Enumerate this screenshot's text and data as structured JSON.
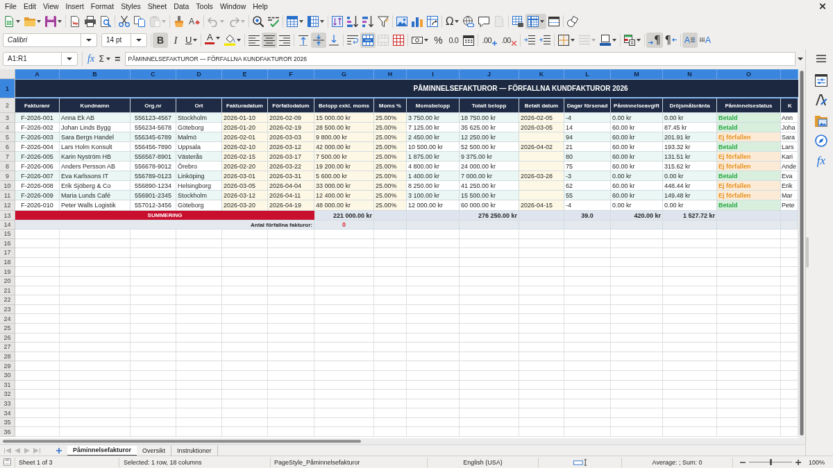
{
  "menu_bar": {
    "items": [
      "File",
      "Edit",
      "View",
      "Insert",
      "Format",
      "Styles",
      "Sheet",
      "Data",
      "Tools",
      "Window",
      "Help"
    ]
  },
  "standard_toolbar": {
    "groups": [
      [
        {
          "kind": "new",
          "on": false,
          "disabled": false,
          "menu": true
        },
        {
          "kind": "open",
          "on": false,
          "disabled": false,
          "menu": true
        },
        {
          "kind": "save",
          "on": false,
          "disabled": false,
          "menu": true
        }
      ],
      [
        {
          "kind": "pdf",
          "on": false,
          "disabled": false,
          "menu": false
        },
        {
          "kind": "print",
          "on": false,
          "disabled": false,
          "menu": false
        },
        {
          "kind": "preview",
          "on": false,
          "disabled": false,
          "menu": false
        }
      ],
      [
        {
          "kind": "cut",
          "on": false,
          "disabled": false,
          "menu": false
        },
        {
          "kind": "copy",
          "on": false,
          "disabled": false,
          "menu": false
        },
        {
          "kind": "paste",
          "on": false,
          "disabled": true,
          "menu": true
        }
      ],
      [
        {
          "kind": "clone",
          "on": false,
          "disabled": false,
          "menu": false
        },
        {
          "kind": "clear",
          "label": "A",
          "on": false,
          "disabled": false,
          "menu": false
        }
      ],
      [
        {
          "kind": "undo",
          "on": false,
          "disabled": true,
          "menu": true
        },
        {
          "kind": "redo",
          "on": false,
          "disabled": true,
          "menu": true
        }
      ],
      [
        {
          "kind": "find",
          "on": false,
          "disabled": false,
          "menu": false
        },
        {
          "kind": "spelling",
          "on": false,
          "disabled": false,
          "menu": false
        }
      ],
      [
        {
          "kind": "row",
          "on": false,
          "disabled": false,
          "menu": true
        },
        {
          "kind": "column",
          "on": false,
          "disabled": false,
          "menu": true
        }
      ],
      [
        {
          "kind": "sort",
          "on": false,
          "disabled": false,
          "menu": false
        },
        {
          "kind": "ascending",
          "on": false,
          "disabled": false,
          "menu": false
        },
        {
          "kind": "descending",
          "on": false,
          "disabled": false,
          "menu": false
        },
        {
          "kind": "filter",
          "on": false,
          "disabled": false,
          "menu": false
        }
      ],
      [
        {
          "kind": "image",
          "on": false,
          "disabled": false,
          "menu": false
        },
        {
          "kind": "chart",
          "on": false,
          "disabled": false,
          "menu": false
        },
        {
          "kind": "pivot",
          "on": false,
          "disabled": false,
          "menu": false
        }
      ],
      [
        {
          "kind": "symbol",
          "label": "Ω",
          "on": false,
          "disabled": false,
          "menu": true
        },
        {
          "kind": "hyperlink",
          "on": false,
          "disabled": false,
          "menu": false
        },
        {
          "kind": "comment",
          "on": false,
          "disabled": false,
          "menu": false
        },
        {
          "kind": "headerfooter",
          "on": false,
          "disabled": true,
          "menu": false
        }
      ],
      [
        {
          "kind": "printarea",
          "on": false,
          "disabled": false,
          "menu": false
        },
        {
          "kind": "freeze",
          "on": true,
          "disabled": false,
          "menu": true
        },
        {
          "kind": "split",
          "on": false,
          "disabled": false,
          "menu": false
        }
      ],
      [
        {
          "kind": "draw",
          "on": false,
          "disabled": false,
          "menu": false
        }
      ]
    ]
  },
  "formatting_toolbar": {
    "font_name": "Calibri",
    "font_size": "14 pt",
    "groups": [
      [
        {
          "kind": "bold",
          "label": "B",
          "on": true,
          "disabled": false,
          "menu": false
        },
        {
          "kind": "italic",
          "label": "I",
          "on": false,
          "disabled": false,
          "menu": false
        },
        {
          "kind": "underline",
          "label": "U",
          "on": false,
          "disabled": false,
          "menu": true
        }
      ],
      [
        {
          "kind": "fontcolor",
          "label": "A",
          "on": false,
          "disabled": false,
          "menu": true
        },
        {
          "kind": "highlight",
          "on": false,
          "disabled": false,
          "menu": true
        }
      ],
      [
        {
          "kind": "alignleft",
          "on": false,
          "disabled": false,
          "menu": false
        },
        {
          "kind": "aligncenter",
          "on": true,
          "disabled": false,
          "menu": false
        },
        {
          "kind": "alignright",
          "on": false,
          "disabled": false,
          "menu": false
        }
      ],
      [
        {
          "kind": "top",
          "on": false,
          "disabled": false,
          "menu": false
        },
        {
          "kind": "middle",
          "on": true,
          "disabled": false,
          "menu": false
        },
        {
          "kind": "bottom",
          "on": false,
          "disabled": false,
          "menu": false
        }
      ],
      [
        {
          "kind": "wrap",
          "on": false,
          "disabled": false,
          "menu": false
        },
        {
          "kind": "mergecenter",
          "on": true,
          "disabled": false,
          "menu": false
        },
        {
          "kind": "merge",
          "on": false,
          "disabled": true,
          "menu": false
        },
        {
          "kind": "unmerge",
          "on": false,
          "disabled": false,
          "menu": false
        }
      ],
      [
        {
          "kind": "currency",
          "on": false,
          "disabled": false,
          "menu": true
        },
        {
          "kind": "percent",
          "label": "%",
          "on": false,
          "disabled": false,
          "menu": false
        },
        {
          "kind": "number",
          "label": "0.0",
          "on": false,
          "disabled": false,
          "menu": false
        },
        {
          "kind": "date",
          "on": false,
          "disabled": false,
          "menu": false
        }
      ],
      [
        {
          "kind": "adddecimal",
          "label": ".00",
          "on": false,
          "disabled": false,
          "menu": false
        },
        {
          "kind": "deletedecimal",
          "label": ".00",
          "on": false,
          "disabled": false,
          "menu": false
        }
      ],
      [
        {
          "kind": "indent",
          "on": false,
          "disabled": false,
          "menu": false
        },
        {
          "kind": "outdent",
          "on": false,
          "disabled": false,
          "menu": false
        }
      ],
      [
        {
          "kind": "borders",
          "on": false,
          "disabled": false,
          "menu": true
        },
        {
          "kind": "borderstyle",
          "on": false,
          "disabled": true,
          "menu": true
        },
        {
          "kind": "bordercolor",
          "on": false,
          "disabled": false,
          "menu": true
        }
      ],
      [
        {
          "kind": "conditional",
          "on": false,
          "disabled": false,
          "menu": true
        }
      ],
      [
        {
          "kind": "ltr",
          "label": "¶",
          "on": true,
          "disabled": false,
          "menu": false
        },
        {
          "kind": "rtl",
          "label": "¶",
          "on": false,
          "disabled": false,
          "menu": false
        }
      ],
      [
        {
          "kind": "textdirection",
          "label": "A",
          "on": true,
          "disabled": false,
          "menu": false
        },
        {
          "kind": "vertical",
          "label": "A",
          "on": false,
          "disabled": false,
          "menu": false
        }
      ]
    ]
  },
  "formula_bar": {
    "name_box": "A1:R1",
    "function_wizard": "fx",
    "sum": "Σ",
    "equals": "=",
    "formula": "PÅMINNELSEFAKTUROR — FÖRFALLNA KUNDFAKTUROR 2026"
  },
  "sidebar": {
    "tabs": [
      {
        "kind": "properties"
      },
      {
        "kind": "styles"
      },
      {
        "kind": "gallery"
      },
      {
        "kind": "navigator"
      },
      {
        "kind": "functions",
        "label": "fx"
      }
    ]
  },
  "sheet": {
    "columns": [
      {
        "label": "A",
        "selected": true
      },
      {
        "label": "B",
        "selected": true
      },
      {
        "label": "C",
        "selected": true
      },
      {
        "label": "D",
        "selected": true
      },
      {
        "label": "E",
        "selected": true
      },
      {
        "label": "F",
        "selected": true
      },
      {
        "label": "G",
        "selected": true
      },
      {
        "label": "H",
        "selected": true
      },
      {
        "label": "I",
        "selected": true
      },
      {
        "label": "J",
        "selected": true
      },
      {
        "label": "K",
        "selected": true
      },
      {
        "label": "L",
        "selected": true
      },
      {
        "label": "M",
        "selected": true
      },
      {
        "label": "N",
        "selected": true
      },
      {
        "label": "O",
        "selected": true
      }
    ],
    "row_headers": [
      {
        "label": "1",
        "selected": true
      },
      {
        "label": "2",
        "selected": false
      },
      {
        "label": "3",
        "selected": false
      },
      {
        "label": "4",
        "selected": false
      },
      {
        "label": "5",
        "selected": false
      },
      {
        "label": "6",
        "selected": false
      },
      {
        "label": "7",
        "selected": false
      },
      {
        "label": "8",
        "selected": false
      },
      {
        "label": "9",
        "selected": false
      },
      {
        "label": "10",
        "selected": false
      },
      {
        "label": "11",
        "selected": false
      },
      {
        "label": "12",
        "selected": false
      },
      {
        "label": "13",
        "selected": false
      },
      {
        "label": "14",
        "selected": false
      },
      {
        "label": "15",
        "selected": false
      },
      {
        "label": "16",
        "selected": false
      },
      {
        "label": "17",
        "selected": false
      },
      {
        "label": "18",
        "selected": false
      },
      {
        "label": "19",
        "selected": false
      },
      {
        "label": "20",
        "selected": false
      },
      {
        "label": "21",
        "selected": false
      },
      {
        "label": "22",
        "selected": false
      },
      {
        "label": "23",
        "selected": false
      },
      {
        "label": "24",
        "selected": false
      },
      {
        "label": "25",
        "selected": false
      },
      {
        "label": "26",
        "selected": false
      },
      {
        "label": "27",
        "selected": false
      },
      {
        "label": "28",
        "selected": false
      },
      {
        "label": "29",
        "selected": false
      },
      {
        "label": "30",
        "selected": false
      },
      {
        "label": "31",
        "selected": false
      },
      {
        "label": "32",
        "selected": false
      },
      {
        "label": "33",
        "selected": false
      },
      {
        "label": "34",
        "selected": false
      },
      {
        "label": "35",
        "selected": false
      },
      {
        "label": "36",
        "selected": false
      }
    ],
    "title": "PÅMINNELSEFAKTUROR — FÖRFALLNA KUNDFAKTUROR 2026",
    "header": [
      "Fakturanr",
      "Kundnamn",
      "Org.nr",
      "Ort",
      "Fakturadatum",
      "Förfallodatum",
      "Belopp exkl. moms",
      "Moms %",
      "Momsbelopp",
      "Totalt belopp",
      "Betalt datum",
      "Dagar försenad",
      "Påminnelseavgift",
      "Dröjsmålsränta",
      "Påminnelsestatus",
      "K"
    ],
    "rows": [
      {
        "invoice_no": "F-2026-001",
        "customer": "Anna Ek AB",
        "org_no": "556123-4567",
        "city": "Stockholm",
        "invoice_date": "2026-01-10",
        "due_date": "2026-02-09",
        "amount_excl_vat": "15 000.00 kr",
        "vat_rate": "25.00%",
        "vat_amount": "3 750.00 kr",
        "total": "18 750.00 kr",
        "paid_date": "2026-02-05",
        "days_late": "-4",
        "reminder_fee": "0.00 kr",
        "interest": "0.00 kr",
        "status": {
          "text": "Betald",
          "color": "#27a844"
        },
        "column_16": "Ann"
      },
      {
        "invoice_no": "F-2026-002",
        "customer": "Johan Linds Bygg",
        "org_no": "556234-5678",
        "city": "Göteborg",
        "invoice_date": "2026-01-20",
        "due_date": "2026-02-19",
        "amount_excl_vat": "28 500.00 kr",
        "vat_rate": "25.00%",
        "vat_amount": "7 125.00 kr",
        "total": "35 625.00 kr",
        "paid_date": "2026-03-05",
        "days_late": "14",
        "reminder_fee": "60.00 kr",
        "interest": "87.45 kr",
        "status": {
          "text": "Betald",
          "color": "#27a844"
        },
        "column_16": "Joha"
      },
      {
        "invoice_no": "F-2026-003",
        "customer": "Sara Bergs Handel",
        "org_no": "556345-6789",
        "city": "Malmö",
        "invoice_date": "2026-02-01",
        "due_date": "2026-03-03",
        "amount_excl_vat": "9 800.00 kr",
        "vat_rate": "25.00%",
        "vat_amount": "2 450.00 kr",
        "total": "12 250.00 kr",
        "days_late": "94",
        "reminder_fee": "60.00 kr",
        "interest": "201.91 kr",
        "status": {
          "text": "Ej förfallen",
          "color": "#e8901c"
        },
        "column_16": "Sara"
      },
      {
        "invoice_no": "F-2026-004",
        "customer": "Lars Holm Konsult",
        "org_no": "556456-7890",
        "city": "Uppsala",
        "invoice_date": "2026-02-10",
        "due_date": "2026-03-12",
        "amount_excl_vat": "42 000.00 kr",
        "vat_rate": "25.00%",
        "vat_amount": "10 500.00 kr",
        "total": "52 500.00 kr",
        "paid_date": "2026-04-02",
        "days_late": "21",
        "reminder_fee": "60.00 kr",
        "interest": "193.32 kr",
        "status": {
          "text": "Betald",
          "color": "#27a844"
        },
        "column_16": "Lars"
      },
      {
        "invoice_no": "F-2026-005",
        "customer": "Karin Nyström HB",
        "org_no": "556567-8901",
        "city": "Västerås",
        "invoice_date": "2026-02-15",
        "due_date": "2026-03-17",
        "amount_excl_vat": "7 500.00 kr",
        "vat_rate": "25.00%",
        "vat_amount": "1 875.00 kr",
        "total": "9 375.00 kr",
        "days_late": "80",
        "reminder_fee": "60.00 kr",
        "interest": "131.51 kr",
        "status": {
          "text": "Ej förfallen",
          "color": "#e8901c"
        },
        "column_16": "Kari"
      },
      {
        "invoice_no": "F-2026-006",
        "customer": "Anders Persson AB",
        "org_no": "556678-9012",
        "city": "Örebro",
        "invoice_date": "2026-02-20",
        "due_date": "2026-03-22",
        "amount_excl_vat": "19 200.00 kr",
        "vat_rate": "25.00%",
        "vat_amount": "4 800.00 kr",
        "total": "24 000.00 kr",
        "days_late": "75",
        "reminder_fee": "60.00 kr",
        "interest": "315.62 kr",
        "status": {
          "text": "Ej förfallen",
          "color": "#e8901c"
        },
        "column_16": "Ande"
      },
      {
        "invoice_no": "F-2026-007",
        "customer": "Eva Karlssons IT",
        "org_no": "556789-0123",
        "city": "Linköping",
        "invoice_date": "2026-03-01",
        "due_date": "2026-03-31",
        "amount_excl_vat": "5 600.00 kr",
        "vat_rate": "25.00%",
        "vat_amount": "1 400.00 kr",
        "total": "7 000.00 kr",
        "paid_date": "2026-03-28",
        "days_late": "-3",
        "reminder_fee": "0.00 kr",
        "interest": "0.00 kr",
        "status": {
          "text": "Betald",
          "color": "#27a844"
        },
        "column_16": "Eva"
      },
      {
        "invoice_no": "F-2026-008",
        "customer": "Erik Sjöberg & Co",
        "org_no": "556890-1234",
        "city": "Helsingborg",
        "invoice_date": "2026-03-05",
        "due_date": "2026-04-04",
        "amount_excl_vat": "33 000.00 kr",
        "vat_rate": "25.00%",
        "vat_amount": "8 250.00 kr",
        "total": "41 250.00 kr",
        "days_late": "62",
        "reminder_fee": "60.00 kr",
        "interest": "448.44 kr",
        "status": {
          "text": "Ej förfallen",
          "color": "#e8901c"
        },
        "column_16": "Erik"
      },
      {
        "invoice_no": "F-2026-009",
        "customer": "Maria Lunds Café",
        "org_no": "556901-2345",
        "city": "Stockholm",
        "invoice_date": "2026-03-12",
        "due_date": "2026-04-11",
        "amount_excl_vat": "12 400.00 kr",
        "vat_rate": "25.00%",
        "vat_amount": "3 100.00 kr",
        "total": "15 500.00 kr",
        "days_late": "55",
        "reminder_fee": "60.00 kr",
        "interest": "149.48 kr",
        "status": {
          "text": "Ej förfallen",
          "color": "#e8901c"
        },
        "column_16": "Mar"
      },
      {
        "invoice_no": "F-2026-010",
        "customer": "Peter Walls Logistik",
        "org_no": "557012-3456",
        "city": "Göteborg",
        "invoice_date": "2026-03-20",
        "due_date": "2026-04-19",
        "amount_excl_vat": "48 000.00 kr",
        "vat_rate": "25.00%",
        "vat_amount": "12 000.00 kr",
        "total": "60 000.00 kr",
        "paid_date": "2026-04-15",
        "days_late": "-4",
        "reminder_fee": "0.00 kr",
        "interest": "0.00 kr",
        "status": {
          "text": "Betald",
          "color": "#27a844"
        },
        "column_16": "Pete"
      }
    ],
    "summary": {
      "label": "SUMMERING",
      "amount_excl_vat": "221 000.00 kr",
      "total": "276 250.00 kr",
      "days_late": "39.0",
      "reminder_fee": "420.00 kr",
      "interest": "1 527.72 kr"
    },
    "count": {
      "label": "Antal förfallna fakturor:",
      "value": "0"
    }
  },
  "sheet_tabs": {
    "navigation_disabled": true,
    "tabs": [
      {
        "label": "Påminnelsefakturor",
        "selected": true
      },
      {
        "label": "Oversikt",
        "selected": false
      },
      {
        "label": "Instruktioner",
        "selected": false
      }
    ]
  },
  "status_bar": {
    "sheet_position": "Sheet 1 of 3",
    "selection": "Selected: 1 row, 18 columns",
    "page_style": "PageStyle_Påminnelsefakturor",
    "language": "English (USA)",
    "statistics": "Average: ; Sum: 0",
    "zoom": {
      "level": 0.5,
      "reading": "100%"
    }
  }
}
